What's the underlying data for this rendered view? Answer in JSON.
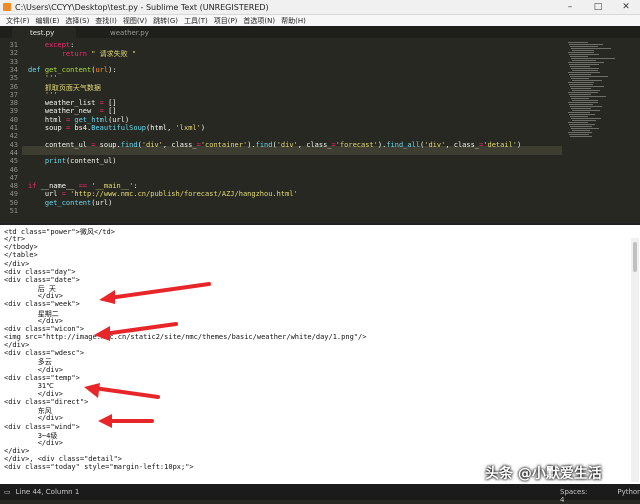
{
  "window": {
    "title": "C:\\Users\\CCYY\\Desktop\\test.py - Sublime Text (UNREGISTERED)",
    "controls": [
      "–",
      "□",
      "✕"
    ]
  },
  "menu": [
    "文件(F)",
    "编辑(E)",
    "选择(S)",
    "查找(I)",
    "视图(V)",
    "跳转(G)",
    "工具(T)",
    "项目(P)",
    "首选项(N)",
    "帮助(H)"
  ],
  "tabs": [
    {
      "label": "test.py",
      "active": true
    },
    {
      "label": "weather.py",
      "active": false
    }
  ],
  "editor": {
    "lines": [
      {
        "num": "31",
        "tokens": [
          {
            "t": "    ",
            "c": ""
          },
          {
            "t": "except",
            "c": "kw"
          },
          {
            "t": ":",
            "c": ""
          }
        ]
      },
      {
        "num": "32",
        "tokens": [
          {
            "t": "        ",
            "c": ""
          },
          {
            "t": "return",
            "c": "kw"
          },
          {
            "t": " ",
            "c": ""
          },
          {
            "t": "\" 请求失败 \"",
            "c": "st"
          }
        ]
      },
      {
        "num": "33",
        "tokens": []
      },
      {
        "num": "34",
        "tokens": [
          {
            "t": "def",
            "c": "bi"
          },
          {
            "t": " ",
            "c": ""
          },
          {
            "t": "get_content",
            "c": "fn"
          },
          {
            "t": "(",
            "c": ""
          },
          {
            "t": "url",
            "c": "it"
          },
          {
            "t": "):",
            "c": ""
          }
        ]
      },
      {
        "num": "35",
        "tokens": [
          {
            "t": "    '''",
            "c": "st"
          }
        ]
      },
      {
        "num": "36",
        "tokens": [
          {
            "t": "    抓取页面天气数据",
            "c": "st"
          }
        ]
      },
      {
        "num": "37",
        "tokens": [
          {
            "t": "    '''",
            "c": "st"
          }
        ]
      },
      {
        "num": "38",
        "tokens": [
          {
            "t": "    weather_list ",
            "c": ""
          },
          {
            "t": "=",
            "c": "kw"
          },
          {
            "t": " []",
            "c": ""
          }
        ]
      },
      {
        "num": "39",
        "tokens": [
          {
            "t": "    weather_new  ",
            "c": ""
          },
          {
            "t": "=",
            "c": "kw"
          },
          {
            "t": " []",
            "c": ""
          }
        ]
      },
      {
        "num": "40",
        "tokens": [
          {
            "t": "    html ",
            "c": ""
          },
          {
            "t": "=",
            "c": "kw"
          },
          {
            "t": " ",
            "c": ""
          },
          {
            "t": "get_html",
            "c": "bi"
          },
          {
            "t": "(url)",
            "c": ""
          }
        ]
      },
      {
        "num": "41",
        "tokens": [
          {
            "t": "    soup ",
            "c": ""
          },
          {
            "t": "=",
            "c": "kw"
          },
          {
            "t": " bs4.",
            "c": ""
          },
          {
            "t": "BeautifulSoup",
            "c": "bi"
          },
          {
            "t": "(html, ",
            "c": ""
          },
          {
            "t": "'lxml'",
            "c": "st"
          },
          {
            "t": ")",
            "c": ""
          }
        ]
      },
      {
        "num": "42",
        "tokens": []
      },
      {
        "num": "43",
        "tokens": [
          {
            "t": "    content_ul ",
            "c": ""
          },
          {
            "t": "=",
            "c": "kw"
          },
          {
            "t": " soup.",
            "c": ""
          },
          {
            "t": "find",
            "c": "bi"
          },
          {
            "t": "(",
            "c": ""
          },
          {
            "t": "'div'",
            "c": "st"
          },
          {
            "t": ", class_",
            "c": ""
          },
          {
            "t": "=",
            "c": "kw"
          },
          {
            "t": "'container'",
            "c": "st"
          },
          {
            "t": ").",
            "c": ""
          },
          {
            "t": "find",
            "c": "bi"
          },
          {
            "t": "(",
            "c": ""
          },
          {
            "t": "'div'",
            "c": "st"
          },
          {
            "t": ", class_",
            "c": ""
          },
          {
            "t": "=",
            "c": "kw"
          },
          {
            "t": "'forecast'",
            "c": "st"
          },
          {
            "t": ").",
            "c": ""
          },
          {
            "t": "find_all",
            "c": "bi"
          },
          {
            "t": "(",
            "c": ""
          },
          {
            "t": "'div'",
            "c": "st"
          },
          {
            "t": ", class_",
            "c": ""
          },
          {
            "t": "=",
            "c": "kw"
          },
          {
            "t": "'detail'",
            "c": "st"
          },
          {
            "t": ")",
            "c": ""
          }
        ]
      },
      {
        "num": "44",
        "tokens": []
      },
      {
        "num": "45",
        "tokens": [
          {
            "t": "    ",
            "c": ""
          },
          {
            "t": "print",
            "c": "bi"
          },
          {
            "t": "(content_ul)",
            "c": ""
          }
        ]
      },
      {
        "num": "46",
        "tokens": []
      },
      {
        "num": "47",
        "tokens": []
      },
      {
        "num": "48",
        "tokens": [
          {
            "t": "if",
            "c": "kw"
          },
          {
            "t": " __name__ ",
            "c": ""
          },
          {
            "t": "==",
            "c": "kw"
          },
          {
            "t": " ",
            "c": ""
          },
          {
            "t": "'__main__'",
            "c": "st"
          },
          {
            "t": ":",
            "c": ""
          }
        ]
      },
      {
        "num": "49",
        "tokens": [
          {
            "t": "    url ",
            "c": ""
          },
          {
            "t": "=",
            "c": "kw"
          },
          {
            "t": " ",
            "c": ""
          },
          {
            "t": "'http://www.nmc.cn/publish/forecast/AZJ/hangzhou.html'",
            "c": "st"
          }
        ]
      },
      {
        "num": "50",
        "tokens": [
          {
            "t": "    ",
            "c": ""
          },
          {
            "t": "get_content",
            "c": "bi"
          },
          {
            "t": "(url)",
            "c": ""
          }
        ]
      },
      {
        "num": "51",
        "tokens": []
      }
    ]
  },
  "console": {
    "lines": [
      "<td class=\"power\">微风</td>",
      "</tr>",
      "</tbody>",
      "</table>",
      "</div>",
      "<div class=\"day\">",
      "<div class=\"date\">",
      "        后 天",
      "        </div>",
      "<div class=\"week\">",
      "        星期二",
      "        </div>",
      "<div class=\"wicon\">",
      "<img src=\"http://image.nmc.cn/static2/site/nmc/themes/basic/weather/white/day/1.png\"/>",
      "</div>",
      "<div class=\"wdesc\">",
      "        多云",
      "        </div>",
      "<div class=\"temp\">",
      "        31℃",
      "        </div>",
      "<div class=\"direct\">",
      "        东风",
      "        </div>",
      "<div class=\"wind\">",
      "        3~4级",
      "        </div>",
      "</div>",
      "</div>, <div class=\"detail\">",
      "<div class=\"today\" style=\"margin-left:10px;\">"
    ]
  },
  "status": {
    "position": "Line 44, Column 1",
    "spaces": "Spaces: 4",
    "syntax": "Python"
  },
  "watermark": "头条 @小默爱生活",
  "colors": {
    "arrow": "#e8262a",
    "editor_bg": "#272822"
  }
}
